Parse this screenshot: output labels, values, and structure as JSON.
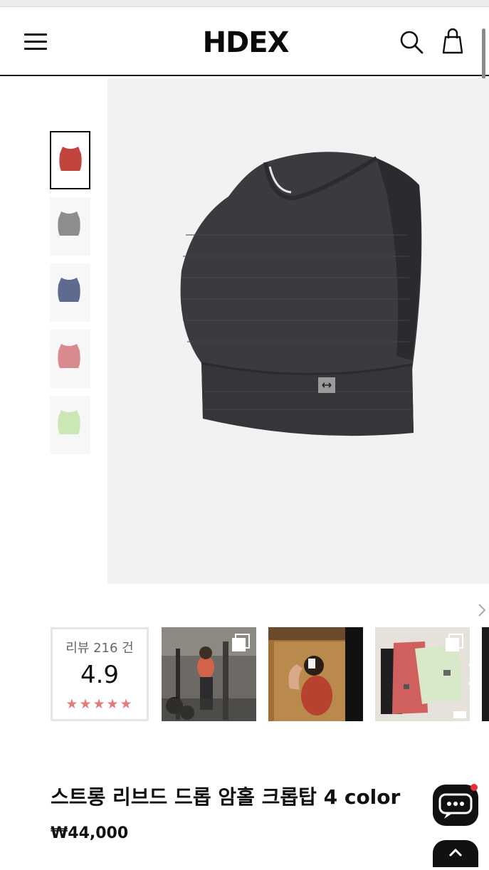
{
  "header": {
    "logo": "HDEX",
    "menu_icon": "hamburger-menu-icon",
    "search_icon": "search-icon",
    "cart_icon": "shopping-bag-icon"
  },
  "gallery": {
    "thumbnails": [
      {
        "color": "#c2453d",
        "name": "red-crop-top"
      },
      {
        "color": "#8d8d8d",
        "name": "gray-crop-top"
      },
      {
        "color": "#5f6b8e",
        "name": "navy-crop-top"
      },
      {
        "color": "#d98a8e",
        "name": "pink-crop-top"
      },
      {
        "color": "#cbe8b4",
        "name": "mint-crop-top"
      }
    ],
    "main_image_color": "#3a3b3f",
    "next_icon": "chevron-right-icon"
  },
  "reviews": {
    "count_label": "리뷰 216 건",
    "score": "4.9",
    "stars": "★★★★★"
  },
  "product": {
    "title": "스트롱 리브드 드롭 암홀 크롭탑 4 color",
    "price": "₩44,000"
  },
  "colors": {
    "accent_star": "#e07c7c",
    "hero_background": "#f2f2f2"
  },
  "floating": {
    "chat_icon": "chat-bubble-icon",
    "top_icon": "scroll-top-icon"
  }
}
